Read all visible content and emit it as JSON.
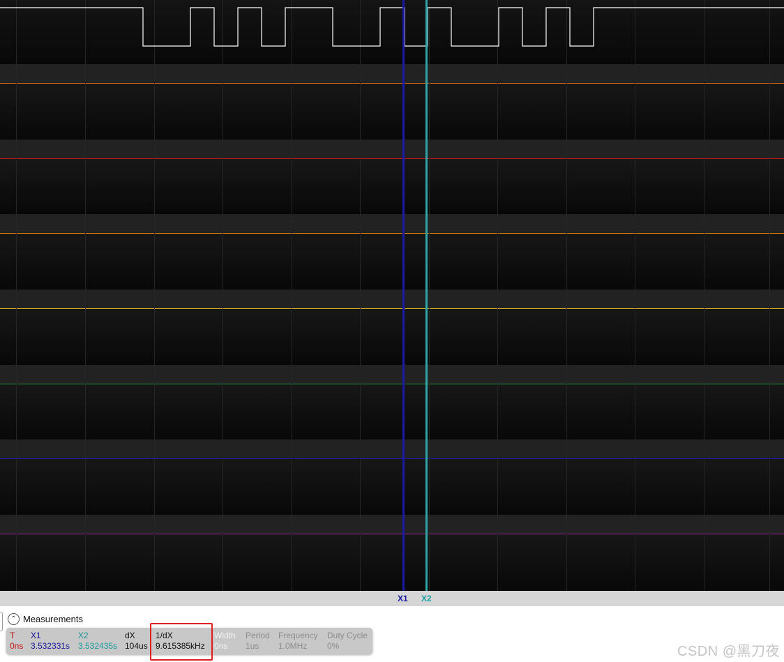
{
  "colors": {
    "scope_bg": "#0d0d0d",
    "x1": "#1a1aa6",
    "x2": "#2ea6a6",
    "highlight": "#e02020"
  },
  "channels": [
    {
      "color": "#ffffff",
      "kind": "digital-pulses"
    },
    {
      "color": "#c8641e",
      "kind": "flat"
    },
    {
      "color": "#d01818",
      "kind": "flat"
    },
    {
      "color": "#e07e10",
      "kind": "flat"
    },
    {
      "color": "#e0c020",
      "kind": "flat"
    },
    {
      "color": "#1a9a3a",
      "kind": "flat"
    },
    {
      "color": "#1a1ab0",
      "kind": "flat"
    },
    {
      "color": "#a01aa0",
      "kind": "flat"
    }
  ],
  "cursors": {
    "x1_label": "X1",
    "x2_label": "X2"
  },
  "measurements": {
    "title": "Measurements",
    "collapse_icon": "chevron-up-icon",
    "t": {
      "label": "T",
      "value": "0ns"
    },
    "x1": {
      "label": "X1",
      "value": "3.532331s"
    },
    "x2": {
      "label": "X2",
      "value": "3.532435s"
    },
    "dx": {
      "label": "dX",
      "value": "104us"
    },
    "inv_dx": {
      "label": "1/dX",
      "value": "9.615385kHz"
    },
    "width": {
      "label": "Width",
      "value": "0ns"
    },
    "period": {
      "label": "Period",
      "value": "1us"
    },
    "frequency": {
      "label": "Frequency",
      "value": "1.0MHz"
    },
    "duty_cycle": {
      "label": "Duty Cycle",
      "value": "0%"
    }
  },
  "watermark": "CSDN @黑刀夜"
}
